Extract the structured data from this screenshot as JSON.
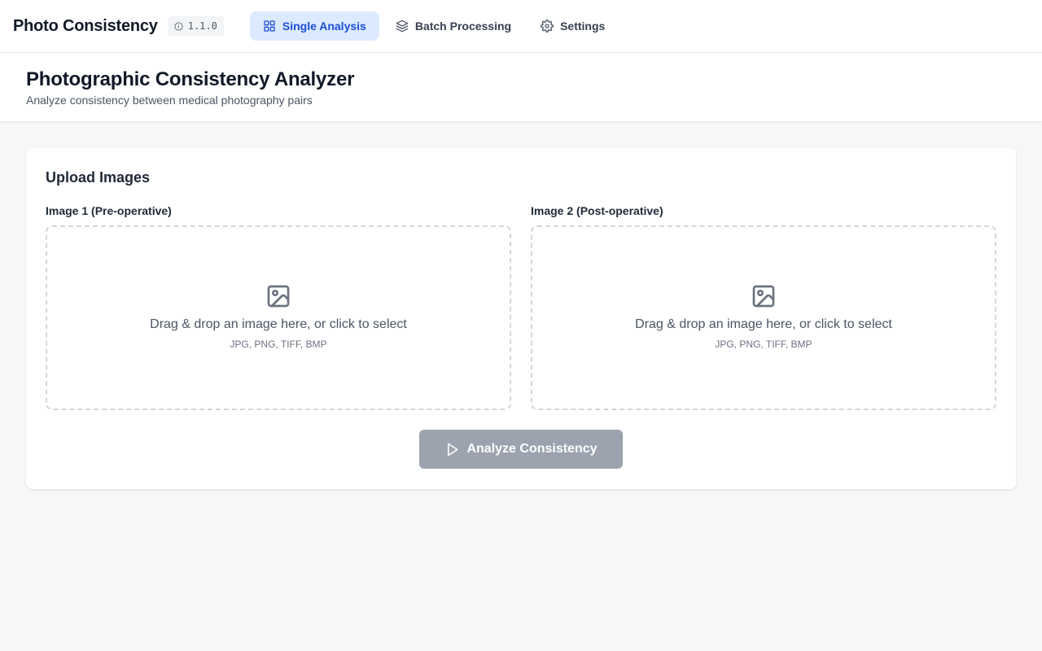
{
  "app": {
    "title": "Photo Consistency",
    "version": "1.1.0"
  },
  "nav": {
    "items": [
      {
        "label": "Single Analysis",
        "icon": "grid-icon",
        "active": true
      },
      {
        "label": "Batch Processing",
        "icon": "layers-icon",
        "active": false
      },
      {
        "label": "Settings",
        "icon": "gear-icon",
        "active": false
      }
    ]
  },
  "header": {
    "title": "Photographic Consistency Analyzer",
    "subtitle": "Analyze consistency between medical photography pairs"
  },
  "upload": {
    "title": "Upload Images",
    "image1": {
      "label": "Image 1 (Pre-operative)",
      "prompt": "Drag & drop an image here, or click to select",
      "formats": "JPG, PNG, TIFF, BMP"
    },
    "image2": {
      "label": "Image 2 (Post-operative)",
      "prompt": "Drag & drop an image here, or click to select",
      "formats": "JPG, PNG, TIFF, BMP"
    },
    "analyze_label": "Analyze Consistency",
    "analyze_disabled": true
  },
  "colors": {
    "accent": "#1d4ed8",
    "active_nav_bg": "#dbeafe",
    "disabled_button": "#9ca3af"
  }
}
